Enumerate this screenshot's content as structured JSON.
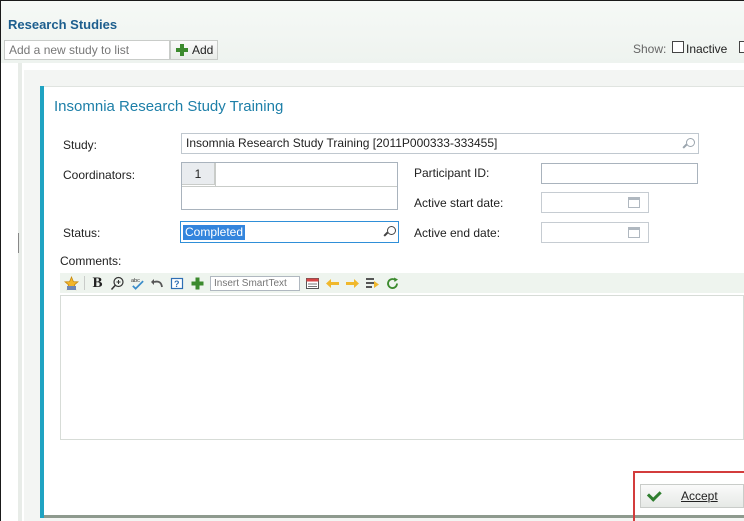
{
  "header": {
    "title": "Research Studies",
    "add_placeholder": "Add a new study to list",
    "add_label": "Add",
    "show_label": "Show:",
    "inactive_label": "Inactive"
  },
  "card": {
    "title": "Insomnia Research Study Training",
    "study_label": "Study:",
    "study_value": "Insomnia Research Study Training [2011P000333-333455]",
    "coordinators_label": "Coordinators:",
    "coordinators_count": "1",
    "participant_id_label": "Participant ID:",
    "participant_id_value": "",
    "active_start_label": "Active start date:",
    "active_start_value": "",
    "status_label": "Status:",
    "status_value": "Completed",
    "active_end_label": "Active end date:",
    "active_end_value": "",
    "comments_label": "Comments:"
  },
  "toolbar": {
    "smarttext_placeholder": "Insert SmartText",
    "icons": [
      "star-icon",
      "bold-icon",
      "zoom-icon",
      "spellcheck-icon",
      "undo-icon",
      "smartlink-icon",
      "add-icon",
      "smarttext-insert-icon",
      "arrow-left-icon",
      "arrow-right-icon",
      "next-field-icon",
      "refresh-icon"
    ]
  },
  "footer": {
    "accept_label": "Accept"
  },
  "colors": {
    "accent": "#1fa3c2",
    "title": "#1d5e8e",
    "highlight": "#3385dd",
    "focus_box": "#d33c3c"
  }
}
